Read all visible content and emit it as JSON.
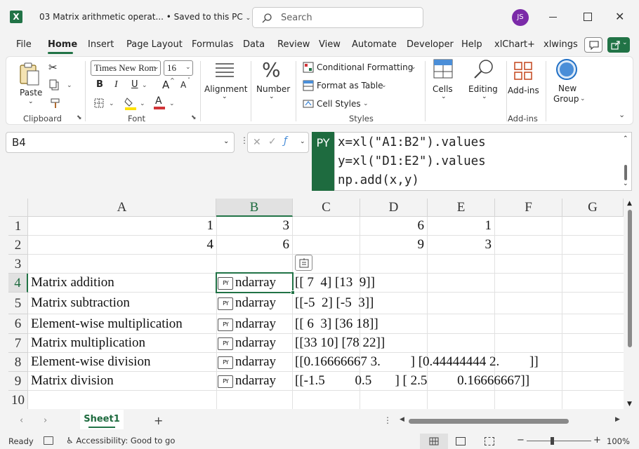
{
  "window": {
    "title": "03 Matrix arithmetic operat...",
    "save_status": "Saved to this PC",
    "search_placeholder": "Search",
    "user_initials": "JS"
  },
  "tabs": [
    "File",
    "Home",
    "Insert",
    "Page Layout",
    "Formulas",
    "Data",
    "Review",
    "View",
    "Automate",
    "Developer",
    "Help",
    "xlChart+",
    "xlwings"
  ],
  "active_tab": "Home",
  "ribbon": {
    "clipboard": {
      "paste": "Paste",
      "label": "Clipboard"
    },
    "font": {
      "name": "Times New Rom",
      "size": "16",
      "bold": "B",
      "italic": "I",
      "underline": "U",
      "grow": "A",
      "shrink": "A",
      "label": "Font"
    },
    "alignment": {
      "label": "Alignment"
    },
    "number": {
      "label": "Number",
      "symbol": "%"
    },
    "styles": {
      "conditional": "Conditional Formatting",
      "format_table": "Format as Table",
      "cell_styles": "Cell Styles",
      "label": "Styles"
    },
    "cells": {
      "label": "Cells"
    },
    "editing": {
      "label": "Editing"
    },
    "addins": {
      "addins": "Add-ins",
      "label": "Add-ins"
    },
    "new_group": {
      "line1": "New",
      "line2": "Group"
    }
  },
  "formula_bar": {
    "name_box": "B4",
    "py_badge": "PY",
    "lines": [
      "x=xl(\"A1:B2\").values",
      "y=xl(\"D1:E2\").values",
      "np.add(x,y)"
    ]
  },
  "grid": {
    "columns": [
      "A",
      "B",
      "C",
      "D",
      "E",
      "F",
      "G"
    ],
    "rows": [
      "1",
      "2",
      "3",
      "4",
      "5",
      "6",
      "7",
      "8",
      "9",
      "10"
    ],
    "selected_cell": "B4",
    "values": {
      "A1": "1",
      "B1": "3",
      "D1": "6",
      "E1": "1",
      "A2": "4",
      "B2": "6",
      "D2": "9",
      "E2": "3",
      "A4": "Matrix addition",
      "A5": "Matrix subtraction",
      "A6": "Element-wise multiplication",
      "A7": "Matrix multiplication",
      "A8": "Element-wise division",
      "A9": "Matrix division",
      "C4": "[[ 7  4] [13  9]]",
      "C5": "[[-5  2] [-5  3]]",
      "C6": "[[ 6  3] [36 18]]",
      "C7": "[[33 10] [78 22]]",
      "C8": "[[0.16666667 3.         ] [0.44444444 2.         ]]",
      "C9": "[[-1.5         0.5       ] [ 2.5         0.16666667]]"
    },
    "py_label": "ndarray",
    "py_icon_text": "PY"
  },
  "sheets": [
    "Sheet1"
  ],
  "active_sheet": "Sheet1",
  "status": {
    "ready": "Ready",
    "accessibility": "Accessibility: Good to go",
    "zoom": "100%"
  },
  "colors": {
    "excel_green": "#217346",
    "py_green": "#1e6b3f",
    "avatar": "#7b2aa8",
    "font_red": "#d13438",
    "highlight_yellow": "#ffe100"
  }
}
